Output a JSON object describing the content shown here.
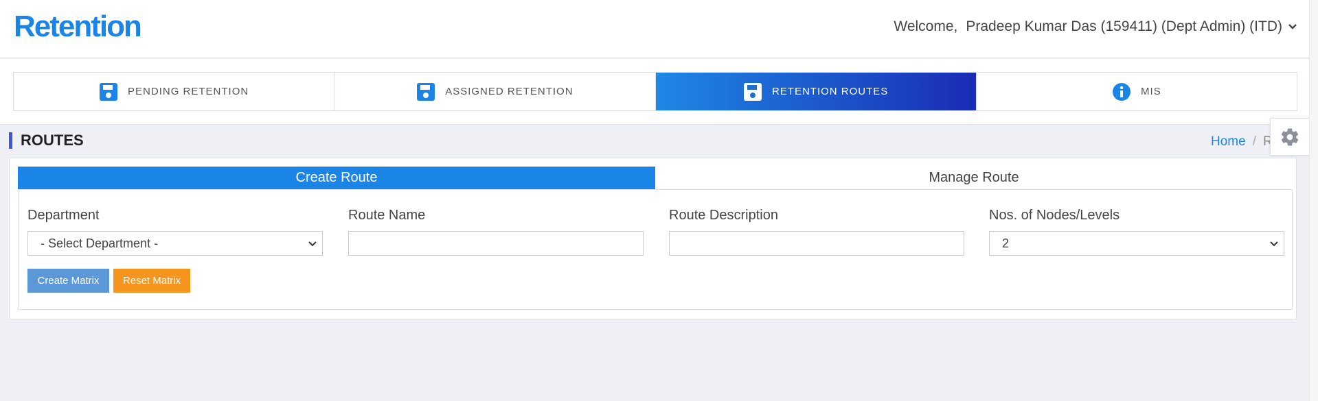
{
  "header": {
    "logo": "Retention",
    "welcome_label": "Welcome,",
    "user": "Pradeep Kumar Das (159411) (Dept Admin) (ITD)"
  },
  "tabs": [
    {
      "label": "PENDING RETENTION",
      "icon": "floppy-disk-icon"
    },
    {
      "label": "ASSIGNED RETENTION",
      "icon": "floppy-disk-icon"
    },
    {
      "label": "RETENTION ROUTES",
      "icon": "floppy-disk-icon",
      "active": true
    },
    {
      "label": "MIS",
      "icon": "info-circle-icon"
    }
  ],
  "page": {
    "title": "ROUTES",
    "breadcrumb_home": "Home",
    "breadcrumb_sep": "/",
    "breadcrumb_current": "R"
  },
  "subtabs": {
    "create": "Create Route",
    "manage": "Manage Route"
  },
  "form": {
    "department_label": "Department",
    "department_value": "- Select Department -",
    "route_name_label": "Route Name",
    "route_name_value": "",
    "route_desc_label": "Route Description",
    "route_desc_value": "",
    "nodes_label": "Nos. of Nodes/Levels",
    "nodes_value": "2"
  },
  "buttons": {
    "create": "Create Matrix",
    "reset": "Reset Matrix"
  },
  "colors": {
    "brand": "#1b84e7",
    "active_tab_start": "#1e88e5",
    "active_tab_end": "#1a2bb5",
    "create_button": "#5c98d8",
    "reset_button": "#f6951d"
  }
}
